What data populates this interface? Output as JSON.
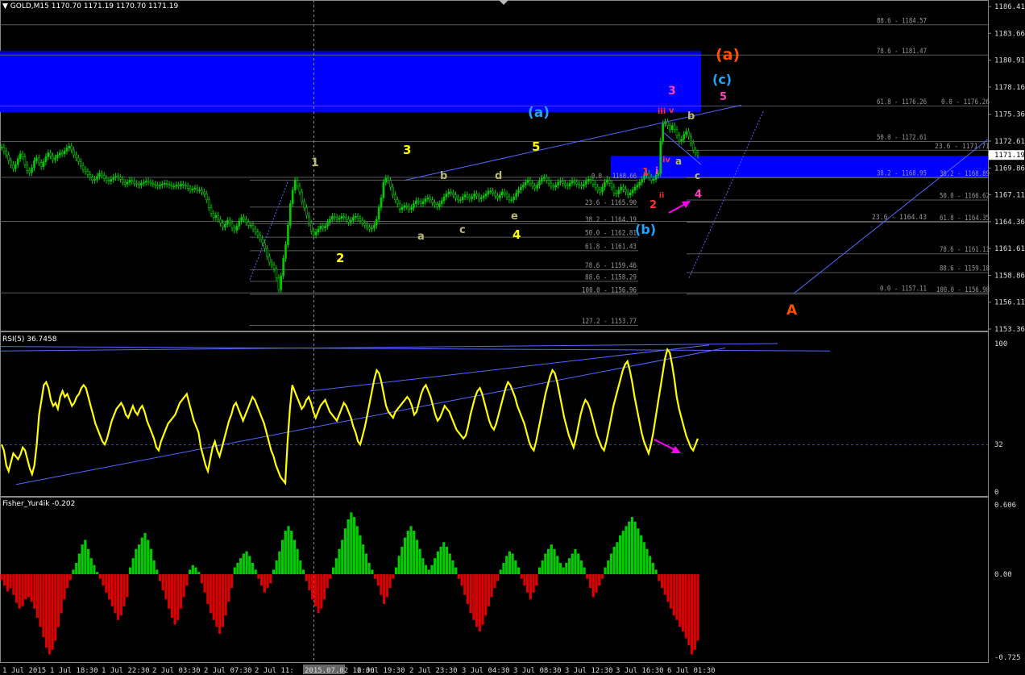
{
  "symbol_header": {
    "arrow": "▼",
    "text": "GOLD,M15  1170.70 1171.19 1170.70 1171.19"
  },
  "colors": {
    "background": "#000000",
    "bull_candle": "#00cc00",
    "zone_blue": "#0000ff",
    "trendline": "#5566ff",
    "rsi_line": "#ffff00",
    "fisher_positive": "#00cc00",
    "fisher_negative": "#dd0000",
    "wave_yellow": "#ffff00",
    "wave_green": "#b8b870",
    "wave_cyan": "#1fa5ff",
    "wave_orange": "#ff4f00",
    "wave_magenta": "#ff40c0",
    "wave_red": "#ff3030",
    "arrow_magenta": "#ff00ff"
  },
  "chart_data": [
    {
      "type": "candlestick",
      "title": "GOLD,M15",
      "ohlc": {
        "open": 1170.7,
        "high": 1171.19,
        "low": 1170.7,
        "close": 1171.19
      },
      "ylim": [
        1153.36,
        1186.41
      ],
      "price_axis_labels": [
        "1186.41",
        "1183.66",
        "1180.91",
        "1178.16",
        "1175.36",
        "1172.61",
        "1169.86",
        "1167.11",
        "1164.36",
        "1161.61",
        "1158.86",
        "1156.11",
        "1153.36"
      ],
      "price_axis_values": [
        1186.41,
        1183.66,
        1180.91,
        1178.16,
        1175.36,
        1172.61,
        1169.86,
        1167.11,
        1164.36,
        1161.61,
        1158.86,
        1156.11,
        1153.36
      ],
      "current_price_label": "1171.19",
      "time_axis_labels": [
        "1 Jul 2015",
        "1 Jul 18:30",
        "1 Jul 22:30",
        "2 Jul 03:30",
        "2 Jul 07:30",
        "2 Jul 11:",
        "2015.07.02 16:00",
        "2 Jul 19:30",
        "2 Jul 23:30",
        "3 Jul 04:30",
        "3 Jul 08:30",
        "3 Jul 12:30",
        "3 Jul 16:30",
        "6 Jul 01:30"
      ],
      "close_series": [
        1172.0,
        1171.6,
        1171.2,
        1170.6,
        1170.2,
        1169.8,
        1170.2,
        1170.8,
        1171.3,
        1171.0,
        1170.2,
        1169.6,
        1169.4,
        1169.9,
        1170.6,
        1170.9,
        1170.4,
        1170.0,
        1170.5,
        1171.0,
        1171.4,
        1171.1,
        1170.7,
        1170.9,
        1171.2,
        1171.4,
        1171.3,
        1171.6,
        1171.9,
        1172.1,
        1171.7,
        1171.2,
        1170.9,
        1170.5,
        1170.1,
        1169.7,
        1169.5,
        1169.2,
        1168.9,
        1168.6,
        1168.7,
        1169.0,
        1169.3,
        1169.1,
        1168.8,
        1168.6,
        1168.5,
        1168.7,
        1168.9,
        1169.0,
        1168.9,
        1168.7,
        1168.4,
        1168.2,
        1168.4,
        1168.6,
        1168.5,
        1168.3,
        1168.2,
        1168.1,
        1168.3,
        1168.4,
        1168.5,
        1168.4,
        1168.3,
        1168.2,
        1168.1,
        1168.0,
        1168.1,
        1168.2,
        1168.3,
        1168.2,
        1168.1,
        1168.0,
        1168.0,
        1168.1,
        1168.0,
        1168.2,
        1168.1,
        1168.0,
        1167.8,
        1167.6,
        1167.7,
        1167.8,
        1167.6,
        1167.6,
        1167.4,
        1167.2,
        1166.6,
        1165.8,
        1165.2,
        1164.8,
        1165.0,
        1164.6,
        1164.2,
        1163.8,
        1164.1,
        1164.5,
        1164.2,
        1163.7,
        1163.5,
        1163.9,
        1164.4,
        1164.8,
        1164.6,
        1164.3,
        1164.0,
        1164.0,
        1163.6,
        1163.3,
        1163.0,
        1162.6,
        1162.2,
        1161.6,
        1160.8,
        1160.2,
        1159.9,
        1159.5,
        1158.6,
        1157.4,
        1158.8,
        1160.6,
        1162.0,
        1164.0,
        1166.2,
        1167.6,
        1168.6,
        1168.0,
        1167.4,
        1166.4,
        1165.8,
        1165.0,
        1164.2,
        1163.4,
        1163.0,
        1163.3,
        1163.6,
        1163.9,
        1163.7,
        1163.9,
        1164.3,
        1164.6,
        1164.9,
        1164.8,
        1164.6,
        1164.7,
        1164.9,
        1164.8,
        1164.6,
        1164.3,
        1164.5,
        1164.8,
        1164.9,
        1164.7,
        1164.5,
        1164.2,
        1164.0,
        1163.8,
        1163.6,
        1163.7,
        1164.0,
        1164.6,
        1165.8,
        1166.8,
        1168.4,
        1168.8,
        1168.6,
        1167.9,
        1167.1,
        1166.6,
        1166.2,
        1165.6,
        1165.8,
        1166.0,
        1165.9,
        1165.6,
        1165.8,
        1166.2,
        1166.5,
        1166.4,
        1166.2,
        1166.4,
        1166.7,
        1166.8,
        1166.6,
        1166.3,
        1166.1,
        1165.9,
        1166.2,
        1166.5,
        1166.9,
        1167.2,
        1167.4,
        1167.3,
        1167.1,
        1166.8,
        1166.6,
        1166.6,
        1166.9,
        1167.1,
        1166.9,
        1166.7,
        1166.9,
        1167.2,
        1167.0,
        1166.7,
        1166.8,
        1167.0,
        1167.2,
        1167.5,
        1167.5,
        1167.3,
        1167.0,
        1166.8,
        1167.1,
        1167.4,
        1167.2,
        1166.9,
        1166.6,
        1166.6,
        1166.9,
        1167.3,
        1167.6,
        1167.9,
        1168.1,
        1168.4,
        1168.6,
        1168.3,
        1168.0,
        1167.8,
        1168.1,
        1168.5,
        1168.8,
        1168.9,
        1168.6,
        1168.3,
        1168.0,
        1167.9,
        1168.1,
        1168.4,
        1168.5,
        1168.3,
        1168.1,
        1168.0,
        1168.3,
        1168.5,
        1168.4,
        1168.2,
        1168.1,
        1168.0,
        1168.2,
        1168.5,
        1168.7,
        1168.6,
        1168.2,
        1167.9,
        1167.6,
        1167.4,
        1167.9,
        1168.4,
        1168.6,
        1168.3,
        1167.9,
        1167.3,
        1167.2,
        1167.6,
        1167.9,
        1167.7,
        1167.4,
        1167.1,
        1167.3,
        1167.6,
        1167.9,
        1168.1,
        1168.4,
        1168.7,
        1169.1,
        1169.3,
        1168.9,
        1168.6,
        1168.7,
        1169.1,
        1169.3,
        1172.6,
        1174.4,
        1174.6,
        1174.2,
        1173.8,
        1174.2,
        1173.8,
        1173.2,
        1172.6,
        1172.8,
        1173.3,
        1173.6,
        1173.1,
        1172.4,
        1171.7,
        1171.4,
        1171.2
      ],
      "fibonacci_labels": [
        {
          "text": "88.6 - 1184.57",
          "value": 1184.57
        },
        {
          "text": "78.6 - 1181.47",
          "value": 1181.47
        },
        {
          "text": "61.8 - 1176.26",
          "value": 1176.26
        },
        {
          "text": "0.0 - 1176.26",
          "value": 1176.26
        },
        {
          "text": "50.0 - 1172.61",
          "value": 1172.61
        },
        {
          "text": "23.6 - 1171.71",
          "value": 1171.71
        },
        {
          "text": "0.0 - 1168.66",
          "value": 1168.66
        },
        {
          "text": "38.2 - 1168.95",
          "value": 1168.95
        },
        {
          "text": "38.2 - 1168.89",
          "value": 1168.89
        },
        {
          "text": "50.0 - 1166.62",
          "value": 1166.62
        },
        {
          "text": "23.6 - 1165.90",
          "value": 1165.9
        },
        {
          "text": "38.2 - 1164.19",
          "value": 1164.19
        },
        {
          "text": "23.6 - 1164.43",
          "value": 1164.43
        },
        {
          "text": "61.8 - 1164.35",
          "value": 1164.35
        },
        {
          "text": "50.0 - 1162.81",
          "value": 1162.81
        },
        {
          "text": "61.8 - 1161.43",
          "value": 1161.43
        },
        {
          "text": "78.6 - 1161.11",
          "value": 1161.11
        },
        {
          "text": "78.6 - 1159.46",
          "value": 1159.46
        },
        {
          "text": "88.6 - 1159.18",
          "value": 1159.18
        },
        {
          "text": "88.6 - 1158.29",
          "value": 1158.29
        },
        {
          "text": "100.0 - 1156.96",
          "value": 1156.96
        },
        {
          "text": "0.0 - 1157.11",
          "value": 1157.11
        },
        {
          "text": "100.0 - 1156.98",
          "value": 1156.98
        },
        {
          "text": "127.2 - 1153.77",
          "value": 1153.77
        }
      ],
      "zones": [
        {
          "from": 1175.6,
          "to": 1181.8
        },
        {
          "from": 1168.8,
          "to": 1171.1
        }
      ],
      "wave_labels": [
        "(a)",
        "(c)",
        "5",
        "3",
        "iii",
        "v",
        "(a)",
        "b",
        "1",
        "3",
        "5",
        "b",
        "d",
        "iv",
        "a",
        "i",
        "1",
        "c",
        "ii",
        "4",
        "2",
        "e",
        "a",
        "c",
        "4",
        "2",
        "(b)",
        "A"
      ]
    },
    {
      "type": "line",
      "title": "RSI(5) 36.7458",
      "ylim": [
        0,
        100
      ],
      "axis_labels": [
        "100",
        "32",
        "0"
      ],
      "level": 32,
      "values": [
        32,
        28,
        18,
        14,
        20,
        26,
        24,
        22,
        25,
        30,
        28,
        22,
        16,
        12,
        18,
        32,
        52,
        62,
        72,
        74,
        70,
        62,
        58,
        60,
        56,
        64,
        68,
        64,
        66,
        62,
        58,
        60,
        64,
        66,
        70,
        72,
        70,
        64,
        58,
        52,
        46,
        42,
        38,
        34,
        32,
        36,
        42,
        48,
        52,
        56,
        58,
        60,
        57,
        52,
        50,
        54,
        58,
        54,
        52,
        56,
        58,
        54,
        48,
        44,
        40,
        36,
        30,
        28,
        34,
        38,
        42,
        46,
        48,
        50,
        52,
        56,
        60,
        62,
        64,
        66,
        60,
        54,
        48,
        44,
        40,
        30,
        24,
        18,
        14,
        22,
        30,
        34,
        28,
        24,
        30,
        36,
        42,
        48,
        52,
        58,
        60,
        56,
        52,
        48,
        52,
        56,
        60,
        64,
        62,
        58,
        54,
        50,
        46,
        40,
        34,
        28,
        24,
        18,
        14,
        10,
        8,
        6,
        34,
        56,
        72,
        68,
        64,
        60,
        56,
        58,
        62,
        64,
        60,
        54,
        50,
        54,
        58,
        60,
        62,
        58,
        54,
        52,
        50,
        48,
        52,
        56,
        60,
        58,
        54,
        50,
        44,
        40,
        34,
        32,
        38,
        44,
        52,
        60,
        68,
        76,
        82,
        80,
        74,
        66,
        58,
        54,
        52,
        50,
        54,
        56,
        58,
        60,
        62,
        64,
        62,
        58,
        52,
        54,
        60,
        66,
        70,
        72,
        68,
        64,
        58,
        52,
        48,
        50,
        54,
        58,
        56,
        54,
        50,
        46,
        42,
        40,
        38,
        36,
        38,
        44,
        52,
        58,
        64,
        68,
        70,
        66,
        60,
        54,
        48,
        44,
        42,
        46,
        52,
        58,
        64,
        70,
        74,
        72,
        68,
        64,
        58,
        54,
        50,
        46,
        40,
        34,
        30,
        28,
        34,
        42,
        50,
        58,
        66,
        72,
        78,
        82,
        80,
        74,
        66,
        58,
        50,
        44,
        38,
        34,
        30,
        36,
        44,
        52,
        58,
        62,
        60,
        56,
        50,
        44,
        38,
        34,
        30,
        28,
        34,
        42,
        50,
        58,
        64,
        70,
        76,
        82,
        86,
        88,
        82,
        74,
        64,
        56,
        48,
        40,
        34,
        30,
        26,
        32,
        40,
        50,
        60,
        70,
        80,
        90,
        96,
        94,
        86,
        76,
        64,
        56,
        50,
        44,
        38,
        34,
        30,
        28,
        32,
        36
      ]
    },
    {
      "type": "bar",
      "title": "Fisher_Yur4ik -0.202",
      "ylim": [
        -0.725,
        0.606
      ],
      "axis_labels": [
        "0.606",
        "0.00",
        "-0.725"
      ],
      "values": [
        -0.05,
        -0.1,
        -0.15,
        -0.12,
        -0.18,
        -0.25,
        -0.3,
        -0.28,
        -0.22,
        -0.2,
        -0.24,
        -0.3,
        -0.38,
        -0.46,
        -0.55,
        -0.64,
        -0.7,
        -0.66,
        -0.58,
        -0.46,
        -0.34,
        -0.22,
        -0.12,
        -0.05,
        0.04,
        0.1,
        0.18,
        0.26,
        0.3,
        0.22,
        0.14,
        0.08,
        0.02,
        -0.04,
        -0.1,
        -0.16,
        -0.22,
        -0.28,
        -0.34,
        -0.4,
        -0.36,
        -0.28,
        -0.2,
        0.06,
        0.14,
        0.22,
        0.26,
        0.32,
        0.36,
        0.3,
        0.22,
        0.12,
        0.04,
        -0.06,
        -0.14,
        -0.22,
        -0.3,
        -0.38,
        -0.44,
        -0.4,
        -0.3,
        -0.2,
        -0.1,
        0.04,
        0.08,
        0.06,
        0.02,
        -0.08,
        -0.16,
        -0.26,
        -0.34,
        -0.4,
        -0.46,
        -0.52,
        -0.46,
        -0.36,
        -0.24,
        -0.12,
        0.06,
        0.1,
        0.14,
        0.18,
        0.2,
        0.16,
        0.1,
        0.04,
        -0.04,
        -0.1,
        -0.16,
        -0.12,
        -0.08,
        0.04,
        0.12,
        0.2,
        0.3,
        0.38,
        0.42,
        0.38,
        0.3,
        0.22,
        0.12,
        0.04,
        -0.06,
        -0.14,
        -0.22,
        -0.28,
        -0.34,
        -0.3,
        -0.22,
        -0.12,
        -0.04,
        0.06,
        0.14,
        0.22,
        0.3,
        0.4,
        0.48,
        0.54,
        0.5,
        0.42,
        0.34,
        0.26,
        0.18,
        0.1,
        0.04,
        -0.04,
        -0.1,
        -0.18,
        -0.26,
        -0.2,
        -0.12,
        -0.04,
        0.06,
        0.16,
        0.24,
        0.32,
        0.38,
        0.42,
        0.38,
        0.3,
        0.22,
        0.14,
        0.08,
        0.04,
        0.08,
        0.14,
        0.2,
        0.24,
        0.28,
        0.24,
        0.18,
        0.12,
        0.06,
        -0.04,
        -0.1,
        -0.18,
        -0.26,
        -0.34,
        -0.4,
        -0.46,
        -0.5,
        -0.44,
        -0.36,
        -0.28,
        -0.2,
        -0.12,
        -0.06,
        0.04,
        0.1,
        0.16,
        0.2,
        0.18,
        0.12,
        0.06,
        -0.04,
        -0.1,
        -0.16,
        -0.22,
        -0.16,
        -0.1,
        0.06,
        0.12,
        0.18,
        0.22,
        0.26,
        0.22,
        0.16,
        0.1,
        0.06,
        0.1,
        0.14,
        0.18,
        0.22,
        0.18,
        0.12,
        0.06,
        -0.04,
        -0.12,
        -0.2,
        -0.16,
        -0.1,
        -0.04,
        0.06,
        0.12,
        0.18,
        0.24,
        0.28,
        0.34,
        0.38,
        0.42,
        0.46,
        0.5,
        0.46,
        0.4,
        0.34,
        0.28,
        0.22,
        0.16,
        0.1,
        0.04,
        -0.06,
        -0.12,
        -0.18,
        -0.24,
        -0.3,
        -0.36,
        -0.4,
        -0.46,
        -0.5,
        -0.56,
        -0.62,
        -0.7,
        -0.66,
        -0.58
      ]
    }
  ],
  "panels": {
    "rsi_title": "RSI(5) 36.7458",
    "fisher_title": "Fisher_Yur4ik -0.202"
  }
}
